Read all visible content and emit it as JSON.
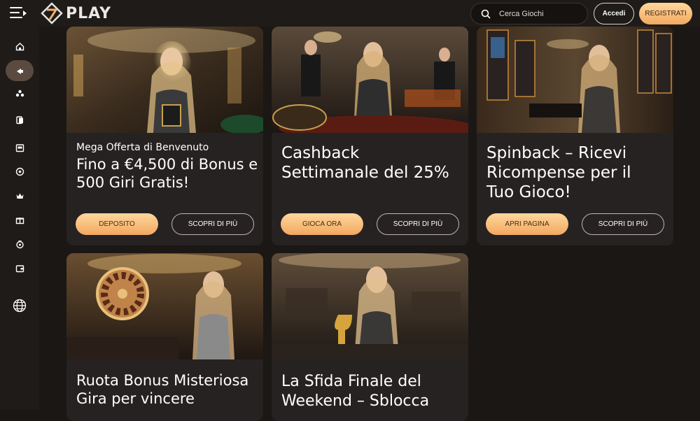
{
  "header": {
    "logo_text": "PLAY",
    "search_placeholder": "Cerca Giochi",
    "login_label": "Accedi",
    "register_label": "REGISTRATI"
  },
  "sidebar": {
    "items": [
      {
        "icon": "home-icon"
      },
      {
        "icon": "promotions-icon",
        "active": true
      },
      {
        "icon": "games-icon"
      },
      {
        "icon": "cards-icon"
      },
      {
        "icon": "slot-machine-icon"
      },
      {
        "icon": "roulette-icon"
      },
      {
        "icon": "crown-icon"
      },
      {
        "icon": "gift-icon"
      },
      {
        "icon": "trophy-icon"
      },
      {
        "icon": "wallet-icon"
      }
    ],
    "language_icon": "globe-icon"
  },
  "promotions": [
    {
      "subtitle": "Mega Offerta di Benvenuto",
      "title_lines": [
        "Fino a €4,500 di Bonus e",
        "500 Giri Gratis!"
      ],
      "primary_label": "DEPOSITO",
      "secondary_label": "SCOPRI DI PIÙ"
    },
    {
      "subtitle": "",
      "title_lines": [
        "Cashback",
        "Settimanale del 25%"
      ],
      "primary_label": "GIOCA ORA",
      "secondary_label": "SCOPRI DI PIÙ"
    },
    {
      "subtitle": "",
      "title_lines": [
        "Spinback – Ricevi",
        "Ricompense per il",
        "Tuo Gioco!"
      ],
      "primary_label": "APRI PAGINA",
      "secondary_label": "SCOPRI DI PIÙ"
    },
    {
      "subtitle": "",
      "title_lines": [
        "Ruota Bonus Misteriosa",
        "Gira per vincere"
      ],
      "primary_label": "",
      "secondary_label": ""
    },
    {
      "subtitle": "",
      "title_lines": [
        "La Sfida Finale del",
        "Weekend – Sblocca"
      ],
      "primary_label": "",
      "secondary_label": ""
    }
  ],
  "colors": {
    "accent_gradient_start": "#ffd79c",
    "accent_gradient_end": "#f2a860",
    "card_bg": "#272222",
    "page_bg": "#1a1715"
  }
}
